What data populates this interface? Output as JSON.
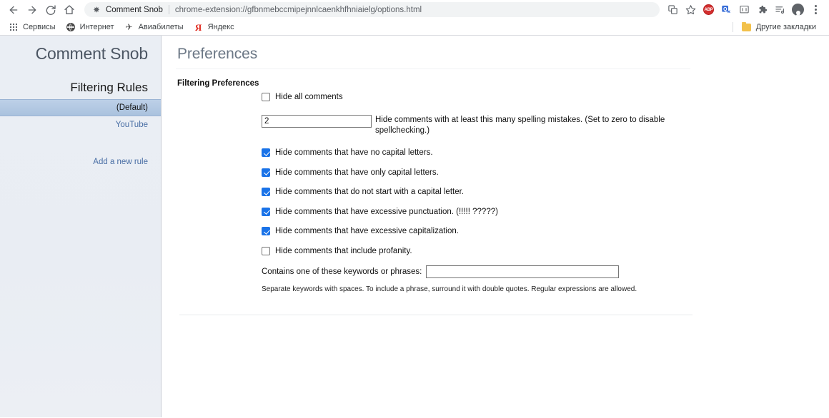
{
  "browser": {
    "nav": {
      "back": "back-arrow",
      "forward": "forward-arrow",
      "reload": "reload",
      "home": "home"
    },
    "omnibox": {
      "favicon": "extension-puzzle-icon",
      "tab_title": "Comment Snob",
      "url": "chrome-extension://gfbnmebccmipejnnlcaenkhfhniaielg/options.html"
    },
    "toolbar_icons": [
      {
        "name": "translate-icon",
        "label": ""
      },
      {
        "name": "bookmark-star-icon",
        "label": ""
      },
      {
        "name": "adblock-plus-icon",
        "label": "ABP"
      },
      {
        "name": "yandex-translate-icon",
        "label": ""
      },
      {
        "name": "screen-capture-icon",
        "label": ""
      },
      {
        "name": "extensions-puzzle-icon",
        "label": ""
      },
      {
        "name": "reading-list-icon",
        "label": ""
      },
      {
        "name": "profile-avatar-icon",
        "label": ""
      },
      {
        "name": "chrome-menu-icon",
        "label": ""
      }
    ],
    "bookmarks": [
      {
        "label": "Сервисы",
        "icon": "apps-grid-icon"
      },
      {
        "label": "Интернет",
        "icon": "globe-icon"
      },
      {
        "label": "Авиабилеты",
        "icon": "airplane-icon"
      },
      {
        "label": "Яндекс",
        "icon": "yandex-icon"
      }
    ],
    "other_bookmarks": {
      "label": "Другие закладки",
      "icon": "folder-icon"
    }
  },
  "sidebar": {
    "title": "Comment Snob",
    "section_heading": "Filtering Rules",
    "rules": [
      {
        "label": "(Default)",
        "selected": true
      },
      {
        "label": "YouTube",
        "selected": false
      }
    ],
    "add_rule": "Add a new rule"
  },
  "main": {
    "page_title": "Preferences",
    "section_label": "Filtering Preferences",
    "hide_all": {
      "label": "Hide all comments",
      "checked": false
    },
    "spelling": {
      "value": "2",
      "text": "Hide comments with at least this many spelling mistakes. (Set to zero to disable spellchecking.)"
    },
    "checkboxes": [
      {
        "label": "Hide comments that have no capital letters.",
        "checked": true
      },
      {
        "label": "Hide comments that have only capital letters.",
        "checked": true
      },
      {
        "label": "Hide comments that do not start with a capital letter.",
        "checked": true
      },
      {
        "label": "Hide comments that have excessive punctuation. (!!!!! ?????)",
        "checked": true
      },
      {
        "label": "Hide comments that have excessive capitalization.",
        "checked": true
      },
      {
        "label": "Hide comments that include profanity.",
        "checked": false
      }
    ],
    "keywords": {
      "label": "Contains one of these keywords or phrases:",
      "value": "",
      "placeholder": ""
    },
    "help_text": "Separate keywords with spaces. To include a phrase, surround it with double quotes. Regular expressions are allowed."
  },
  "colors": {
    "selected_rule_bg": "#aac2de",
    "link": "#4a6fa5",
    "checkbox_accent": "#1a73e8",
    "sidebar_bg": "#eaeef4"
  }
}
